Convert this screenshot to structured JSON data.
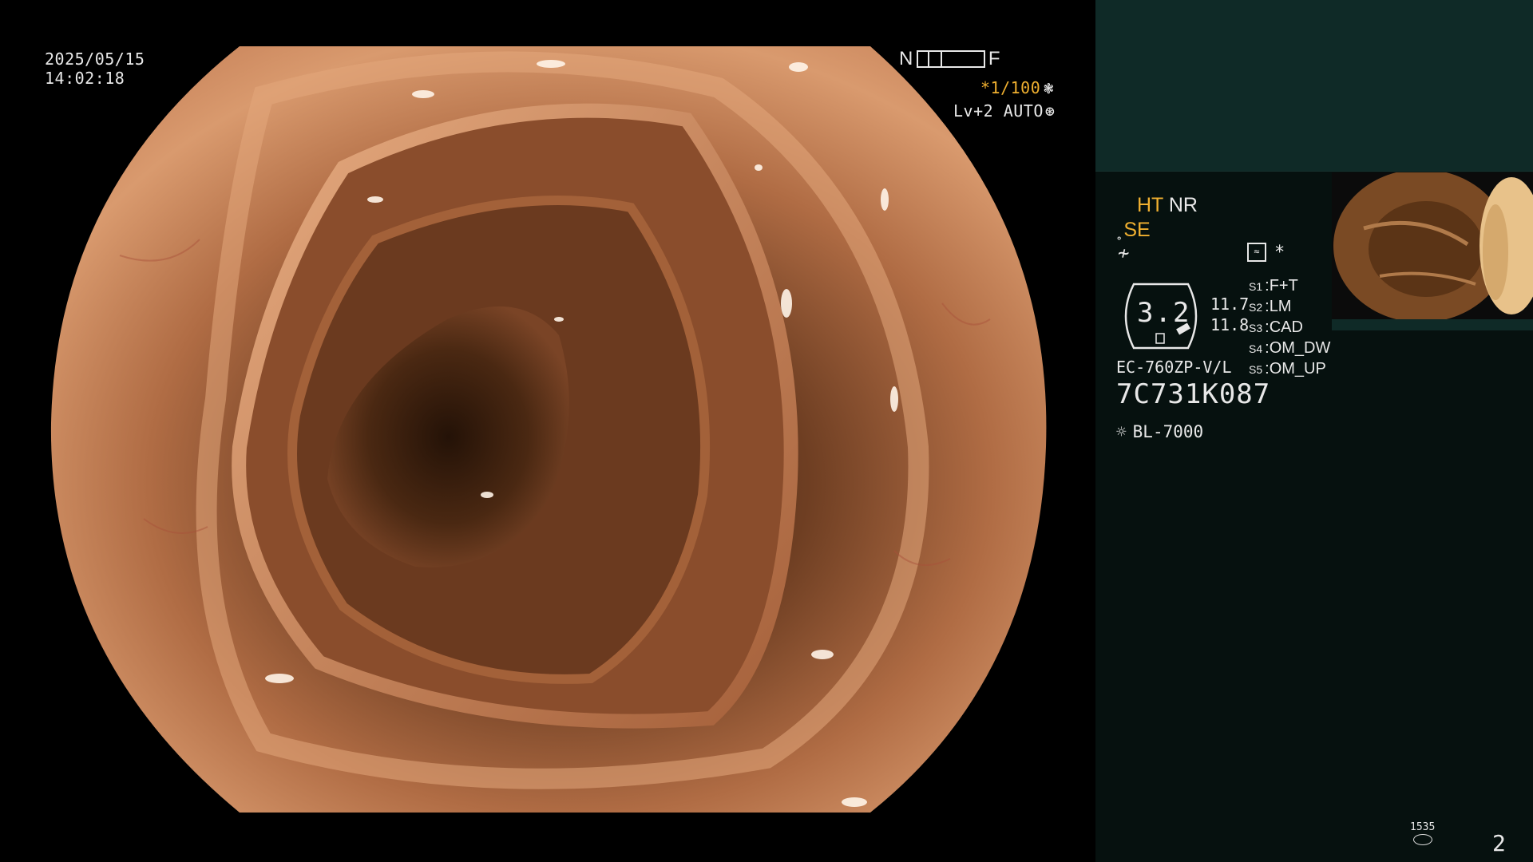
{
  "osd": {
    "date": "2025/05/15",
    "time": "14:02:18",
    "nf_left": "N",
    "nf_right": "F",
    "shutter": "*1/100",
    "shutter_icon": "aperture-icon",
    "iris": "Lv+2 AUTO",
    "iris_icon": "iris-icon"
  },
  "panel": {
    "ht": "HT",
    "nr": "NR",
    "se": "SE",
    "dial_value": "3.2",
    "readouts": [
      "11.7",
      "11.8"
    ],
    "model": "EC-760ZP-V/L",
    "serial": "7C731K087",
    "light_source": "BL-7000",
    "asterisk": "*",
    "switches": [
      {
        "key": "S1",
        "sep": ":",
        "value": "F+T"
      },
      {
        "key": "S2",
        "sep": ":",
        "value": "LM"
      },
      {
        "key": "S3",
        "sep": ":",
        "value": "CAD"
      },
      {
        "key": "S4",
        "sep": ":",
        "value": "OM_DW"
      },
      {
        "key": "S5",
        "sep": ":",
        "value": "OM_UP"
      }
    ],
    "counter": "1535",
    "page": "2"
  },
  "colors": {
    "accent": "#f0b030",
    "text": "#e8e8e8",
    "panel_bg": "#06110f",
    "panel_top": "#0f2a27"
  }
}
